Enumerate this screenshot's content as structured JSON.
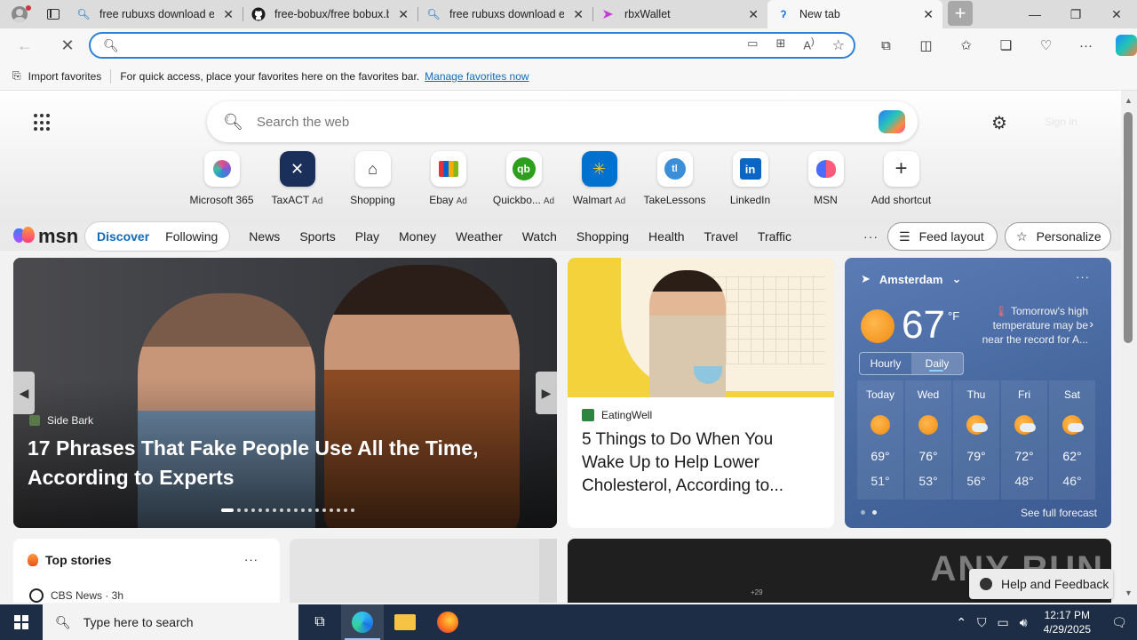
{
  "browser": {
    "tabs": [
      {
        "title": "free rubuxs download ex",
        "icon": "search-icon"
      },
      {
        "title": "free-bobux/free bobux.b",
        "icon": "github-icon"
      },
      {
        "title": "free rubuxs download ex",
        "icon": "search-icon"
      },
      {
        "title": "rbxWallet",
        "icon": "rbxwallet-icon"
      },
      {
        "title": "New tab",
        "icon": "edge-icon",
        "active": true
      }
    ],
    "address": {
      "value": ""
    },
    "favorites_bar": {
      "import_label": "Import favorites",
      "hint": "For quick access, place your favorites here on the favorites bar.",
      "manage_link": "Manage favorites now"
    }
  },
  "newtab": {
    "search": {
      "placeholder": "Search the web"
    },
    "signin": "Sign in",
    "shortcuts": [
      {
        "label": "Microsoft 365",
        "ad": ""
      },
      {
        "label": "TaxACT",
        "ad": "Ad"
      },
      {
        "label": "Shopping",
        "ad": ""
      },
      {
        "label": "Ebay",
        "ad": "Ad"
      },
      {
        "label": "Quickbo...",
        "ad": "Ad"
      },
      {
        "label": "Walmart",
        "ad": "Ad"
      },
      {
        "label": "TakeLessons",
        "ad": ""
      },
      {
        "label": "LinkedIn",
        "ad": ""
      },
      {
        "label": "MSN",
        "ad": ""
      },
      {
        "label": "Add shortcut",
        "ad": ""
      }
    ]
  },
  "msn": {
    "logo": "msn",
    "discover": "Discover",
    "following": "Following",
    "categories": [
      "News",
      "Sports",
      "Play",
      "Money",
      "Weather",
      "Watch",
      "Shopping",
      "Health",
      "Travel",
      "Traffic"
    ],
    "more": "···",
    "feed_layout": "Feed layout",
    "personalize": "Personalize"
  },
  "hero": {
    "source": "Side Bark",
    "title": "17 Phrases That Fake People Use All the Time, According to Experts"
  },
  "article": {
    "source": "EatingWell",
    "title": "5 Things to Do When You Wake Up to Help Lower Cholesterol, According to..."
  },
  "weather": {
    "location": "Amsterdam",
    "temp": "67",
    "unit": "°F",
    "note": "Tomorrow's high temperature may be near the record for A...",
    "tabs": {
      "hourly": "Hourly",
      "daily": "Daily"
    },
    "days": [
      {
        "name": "Today",
        "hi": "69°",
        "lo": "51°",
        "icon": "sunny-icon"
      },
      {
        "name": "Wed",
        "hi": "76°",
        "lo": "53°",
        "icon": "sunny-icon"
      },
      {
        "name": "Thu",
        "hi": "79°",
        "lo": "56°",
        "icon": "partly-sunny-icon"
      },
      {
        "name": "Fri",
        "hi": "72°",
        "lo": "48°",
        "icon": "partly-sunny-icon"
      },
      {
        "name": "Sat",
        "hi": "62°",
        "lo": "46°",
        "icon": "mostly-cloudy-icon"
      }
    ],
    "see_full": "See full forecast"
  },
  "top_stories": {
    "title": "Top stories",
    "first_item": "CBS News · 3h"
  },
  "video": {
    "watermark": "ANY RUN",
    "small": "+29"
  },
  "help": "Help and Feedback",
  "taskbar": {
    "search_placeholder": "Type here to search",
    "time": "12:17 PM",
    "date": "4/29/2025"
  }
}
